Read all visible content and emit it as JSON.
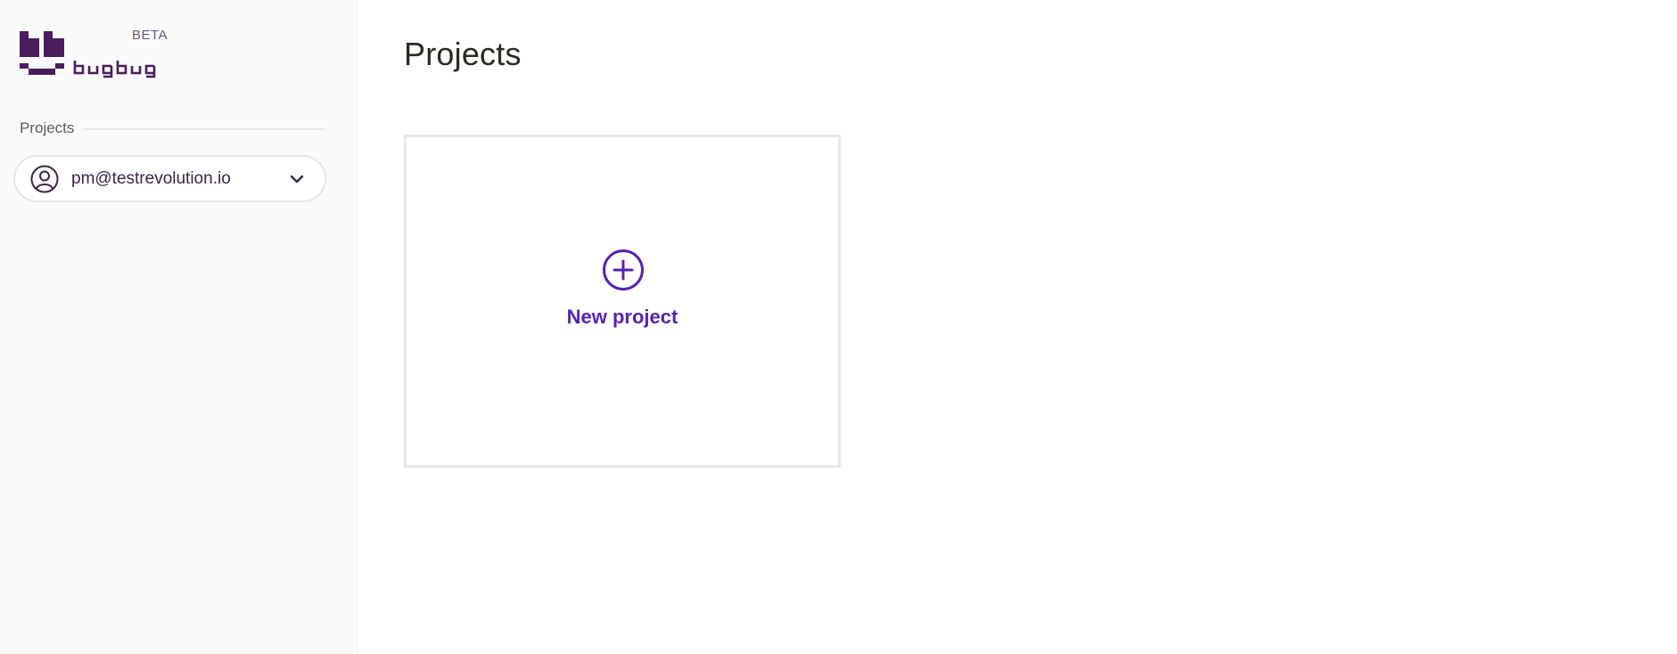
{
  "brand": {
    "name": "bugbug",
    "badge": "BETA",
    "logo_color": "#4a1e5c"
  },
  "sidebar": {
    "section_label": "Projects",
    "account": {
      "email": "pm@testrevolution.io",
      "icon": "user-circle-icon",
      "dropdown_icon": "chevron-down-icon"
    }
  },
  "main": {
    "title": "Projects",
    "new_project": {
      "label": "New project",
      "icon": "plus-circle-icon",
      "accent": "#5424b0"
    }
  }
}
